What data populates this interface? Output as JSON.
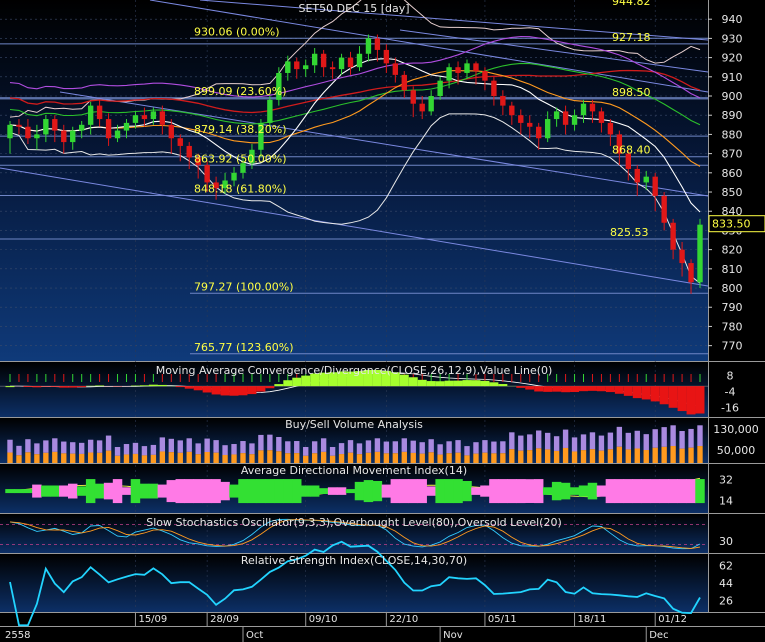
{
  "chart_data": [
    {
      "type": "candlestick",
      "title": "SET50 DEC 15  [day]",
      "right_axis_ticks": [
        940,
        930,
        920,
        910,
        900,
        890,
        880,
        870,
        860,
        850,
        840,
        830,
        820,
        810,
        800,
        790,
        780,
        770
      ],
      "ylim": [
        762,
        950
      ],
      "last_price_tag": "833.50",
      "top_partial_label": "944.82",
      "fib_levels": [
        {
          "label": "930.06 (0.00%)",
          "value": 930.06
        },
        {
          "label": "899.09 (23.60%)",
          "value": 899.09
        },
        {
          "label": "879.14 (38.20%)",
          "value": 879.14
        },
        {
          "label": "863.92 (50.00%)",
          "value": 863.92
        },
        {
          "label": "848.18 (61.80%)",
          "value": 848.18
        },
        {
          "label": "797.27 (100.00%)",
          "value": 797.27
        },
        {
          "label": "765.77 (123.60%)",
          "value": 765.77
        }
      ],
      "annotations": [
        {
          "label": "927.18",
          "value": 927.18
        },
        {
          "label": "898.50",
          "value": 898.5
        },
        {
          "label": "868.40",
          "value": 868.4
        },
        {
          "label": "825.53",
          "value": 825.53
        }
      ],
      "candles": [
        [
          878,
          885,
          870,
          887
        ],
        [
          885,
          884,
          880,
          888
        ],
        [
          884,
          878,
          875,
          888
        ],
        [
          878,
          880,
          872,
          885
        ],
        [
          880,
          888,
          876,
          890
        ],
        [
          888,
          882,
          876,
          890
        ],
        [
          882,
          876,
          870,
          885
        ],
        [
          876,
          882,
          872,
          884
        ],
        [
          882,
          885,
          878,
          887
        ],
        [
          885,
          895,
          880,
          897
        ],
        [
          895,
          888,
          884,
          898
        ],
        [
          888,
          878,
          874,
          891
        ],
        [
          878,
          882,
          876,
          885
        ],
        [
          882,
          886,
          878,
          888
        ],
        [
          886,
          890,
          883,
          892
        ],
        [
          890,
          888,
          884,
          894
        ],
        [
          888,
          892,
          885,
          894
        ],
        [
          892,
          885,
          880,
          895
        ],
        [
          885,
          878,
          870,
          888
        ],
        [
          878,
          874,
          866,
          880
        ],
        [
          874,
          868,
          862,
          876
        ],
        [
          868,
          864,
          857,
          870
        ],
        [
          864,
          855,
          850,
          866
        ],
        [
          855,
          852,
          846,
          858
        ],
        [
          852,
          856,
          849,
          860
        ],
        [
          856,
          860,
          853,
          863
        ],
        [
          860,
          865,
          857,
          868
        ],
        [
          865,
          872,
          862,
          875
        ],
        [
          872,
          886,
          868,
          888
        ],
        [
          886,
          898,
          882,
          900
        ],
        [
          898,
          912,
          895,
          915
        ],
        [
          912,
          918,
          908,
          921
        ],
        [
          918,
          914,
          909,
          920
        ],
        [
          914,
          916,
          910,
          919
        ],
        [
          916,
          922,
          912,
          925
        ],
        [
          922,
          915,
          910,
          924
        ],
        [
          915,
          914,
          909,
          918
        ],
        [
          914,
          920,
          911,
          922
        ],
        [
          920,
          915,
          911,
          923
        ],
        [
          915,
          922,
          913,
          926
        ],
        [
          922,
          930,
          918,
          932
        ],
        [
          930,
          924,
          918,
          932
        ],
        [
          924,
          917,
          912,
          927
        ],
        [
          917,
          911,
          907,
          920
        ],
        [
          911,
          903,
          899,
          913
        ],
        [
          903,
          896,
          889,
          905
        ],
        [
          896,
          892,
          888,
          900
        ],
        [
          892,
          900,
          890,
          903
        ],
        [
          900,
          908,
          898,
          910
        ],
        [
          908,
          915,
          904,
          917
        ],
        [
          915,
          912,
          906,
          918
        ],
        [
          912,
          917,
          909,
          919
        ],
        [
          917,
          913,
          906,
          918
        ],
        [
          913,
          908,
          903,
          915
        ],
        [
          908,
          900,
          895,
          910
        ],
        [
          900,
          895,
          890,
          903
        ],
        [
          895,
          890,
          885,
          897
        ],
        [
          890,
          886,
          880,
          893
        ],
        [
          886,
          884,
          878,
          890
        ],
        [
          884,
          878,
          872,
          886
        ],
        [
          878,
          888,
          876,
          892
        ],
        [
          888,
          892,
          884,
          894
        ],
        [
          892,
          885,
          880,
          895
        ],
        [
          885,
          890,
          882,
          893
        ],
        [
          890,
          896,
          886,
          898
        ],
        [
          896,
          892,
          886,
          898
        ],
        [
          892,
          886,
          881,
          894
        ],
        [
          886,
          880,
          874,
          888
        ],
        [
          880,
          870,
          864,
          882
        ],
        [
          870,
          862,
          856,
          872
        ],
        [
          862,
          855,
          848,
          864
        ],
        [
          855,
          858,
          851,
          861
        ],
        [
          858,
          848,
          840,
          860
        ],
        [
          848,
          834,
          830,
          850
        ],
        [
          834,
          820,
          815,
          836
        ],
        [
          820,
          813,
          806,
          824
        ],
        [
          813,
          803,
          797,
          815
        ],
        [
          803,
          833,
          800,
          836
        ]
      ],
      "macd": {
        "title": "Moving Average Convergence/Divergence(CLOSE,26,12,9),Value Line(0)",
        "ticks": [
          "8",
          "-4",
          "-16"
        ]
      },
      "volume": {
        "title": "Buy/Sell Volume Analysis",
        "ticks": [
          "130,000",
          "50,000"
        ]
      },
      "adx": {
        "title": "Average Directional Movement Index(14)",
        "ticks": [
          "32",
          "14"
        ]
      },
      "stoch": {
        "title": "Slow Stochastics Oscillator(9,3,3),Overbought Level(80),Oversold Level(20)",
        "ticks": [
          "30"
        ]
      },
      "rsi": {
        "title": "Relative Strength Index(CLOSE,14,30,70)",
        "ticks": [
          "62",
          "44",
          "26"
        ]
      },
      "x_date_labels": [
        {
          "label": "15/09",
          "idx": 14
        },
        {
          "label": "28/09",
          "idx": 22
        },
        {
          "label": "09/10",
          "idx": 33
        },
        {
          "label": "22/10",
          "idx": 42
        },
        {
          "label": "05/11",
          "idx": 53
        },
        {
          "label": "18/11",
          "idx": 63
        },
        {
          "label": "01/12",
          "idx": 72
        }
      ],
      "x_month_labels": [
        {
          "label": "2558",
          "idx": 0
        },
        {
          "label": "Oct",
          "idx": 26
        },
        {
          "label": "Nov",
          "idx": 48
        },
        {
          "label": "Dec",
          "idx": 71
        }
      ]
    }
  ]
}
